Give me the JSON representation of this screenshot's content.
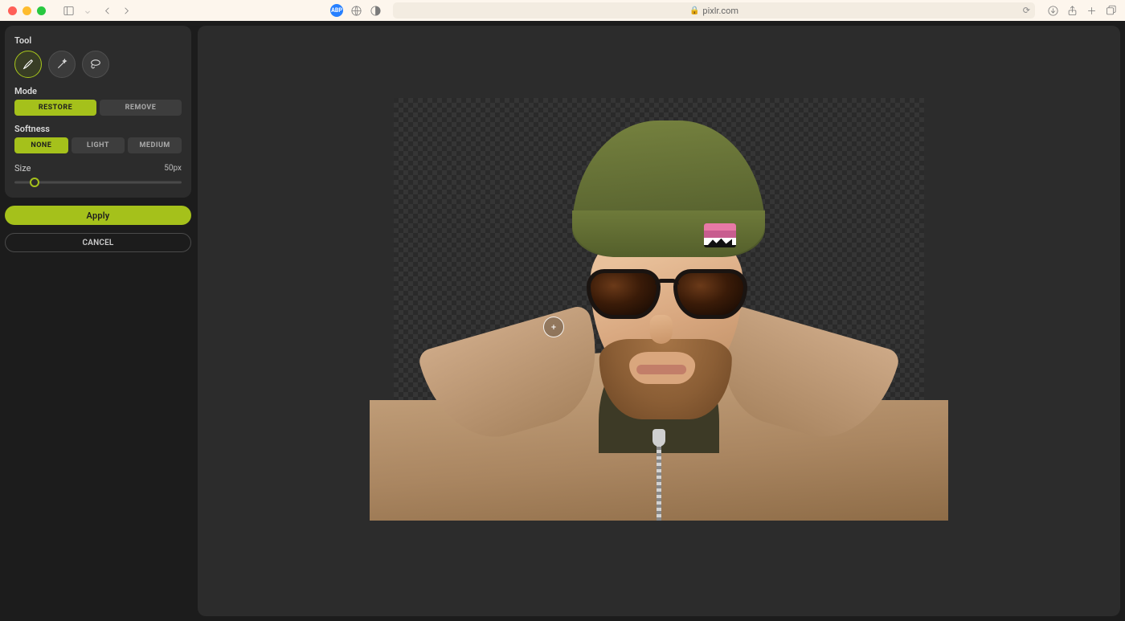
{
  "browser": {
    "url_host": "pixlr.com"
  },
  "panel": {
    "tool_label": "Tool",
    "mode_label": "Mode",
    "mode_options": {
      "restore": "Restore",
      "remove": "Remove"
    },
    "softness_label": "Softness",
    "softness_options": {
      "none": "None",
      "light": "Light",
      "medium": "Medium"
    },
    "size_label": "Size",
    "size_value": "50px"
  },
  "actions": {
    "apply": "Apply",
    "cancel": "Cancel"
  }
}
